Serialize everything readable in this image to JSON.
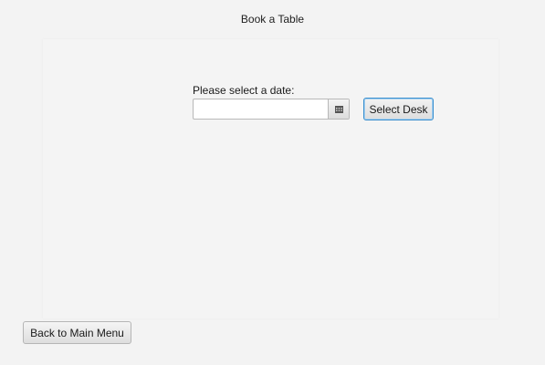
{
  "window": {
    "title": "Book a Table"
  },
  "form": {
    "date_label": "Please select a date:",
    "date_value": "",
    "calendar_icon": "calendar-icon",
    "select_desk_label": "Select Desk"
  },
  "footer": {
    "back_label": "Back to Main Menu"
  },
  "colors": {
    "background": "#f3f3f3",
    "focus_border": "#3b8fce"
  }
}
